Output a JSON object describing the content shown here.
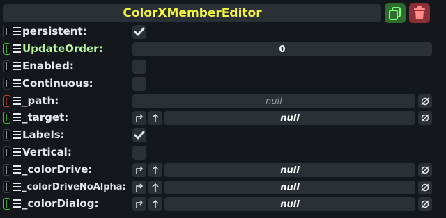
{
  "header": {
    "title": "ColorXMemberEditor",
    "duplicate_icon": "duplicate-icon",
    "delete_icon": "trash-icon"
  },
  "rows": [
    {
      "label": "persistent:",
      "value": "",
      "checked": true
    },
    {
      "label": "UpdateOrder:",
      "value": "0"
    },
    {
      "label": "Enabled:",
      "checked": false
    },
    {
      "label": "Continuous:",
      "checked": false
    },
    {
      "label": "_path:",
      "value": "null"
    },
    {
      "label": "_target:",
      "value": "null"
    },
    {
      "label": "Labels:",
      "checked": true
    },
    {
      "label": "Vertical:",
      "checked": false
    },
    {
      "label": "_colorDrive:",
      "value": "null"
    },
    {
      "label": "_colorDriveNoAlpha:",
      "value": "null"
    },
    {
      "label": "_colorDialog:",
      "value": "null"
    }
  ],
  "colors": {
    "title": "#f1f542",
    "accent_green": "#3ec43e",
    "accent_red": "#c43e3e",
    "panel": "#2b2f36",
    "background": "#14171c"
  }
}
